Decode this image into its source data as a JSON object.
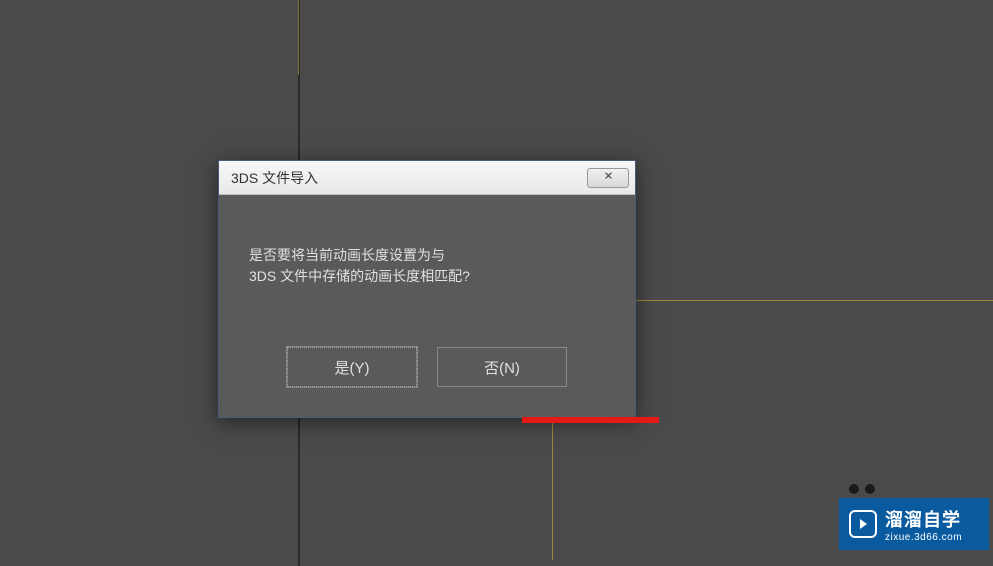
{
  "dialog": {
    "title": "3DS 文件导入",
    "message_line1": "是否要将当前动画长度设置为与",
    "message_line2": "3DS 文件中存储的动画长度相匹配?",
    "yes_label": "是(Y)",
    "no_label": "否(N)"
  },
  "watermark": {
    "main": "溜溜自学",
    "sub": "zixue.3d66.com"
  }
}
